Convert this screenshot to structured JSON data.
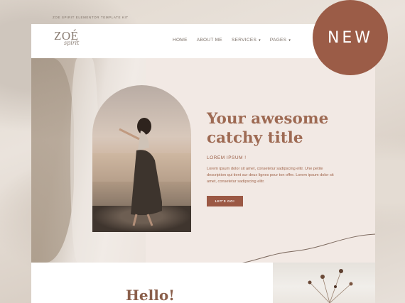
{
  "kit_label": "ZOE SPIRIT ELEMENTOR TEMPLATE KIT",
  "logo": {
    "main": "ZOÉ",
    "script": "spirit"
  },
  "nav": {
    "items": [
      {
        "label": "HOME",
        "has_caret": false
      },
      {
        "label": "ABOUT ME",
        "has_caret": false
      },
      {
        "label": "SERVICES",
        "has_caret": true
      },
      {
        "label": "PAGES",
        "has_caret": true
      }
    ],
    "caret_glyph": "▾"
  },
  "badge": {
    "label": "NEW",
    "color": "#9b5c47"
  },
  "hero": {
    "title": "Your awesome catchy title",
    "eyebrow": "LOREM IPSUM !",
    "body": "Lorem ipsum dolor sit amet, consetetur sadipscing elitr. Une petite description qui tient sur deux lignes pour ton offre. Lorem ipsum dolor sit amet, consetetur sadipscing elitr.",
    "cta_label": "LET'S GO!",
    "accent_color": "#9e6a53"
  },
  "section2": {
    "heading": "Hello!"
  }
}
